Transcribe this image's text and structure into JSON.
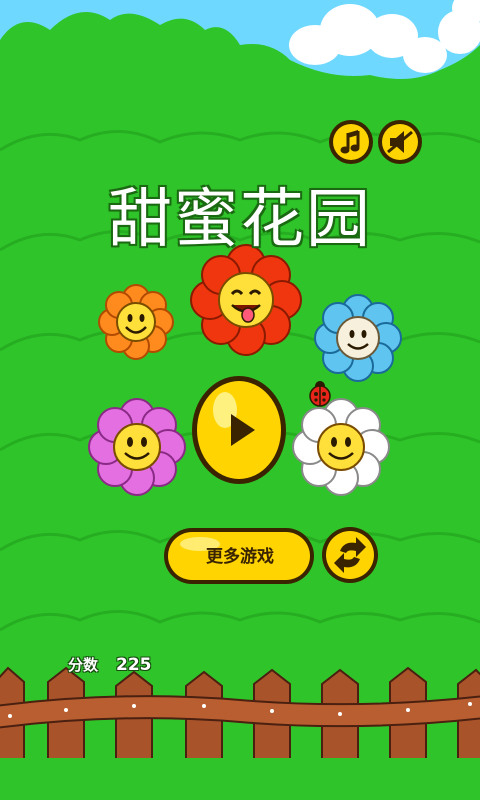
{
  "game": {
    "title": "甜蜜花园",
    "more_games_label": "更多游戏",
    "score_label": "分数",
    "score_value": "225"
  },
  "buttons": {
    "music": "music-note-icon",
    "sound": "sound-muted-icon",
    "play": "play-icon",
    "switch": "refresh-arrows-icon"
  },
  "colors": {
    "sky": "#6fd8ff",
    "grass": "#2fc52a",
    "grass_dark": "#22a41d",
    "button_yellow": "#ffd400",
    "button_outline": "#3a2400",
    "fence": "#a9532b"
  }
}
